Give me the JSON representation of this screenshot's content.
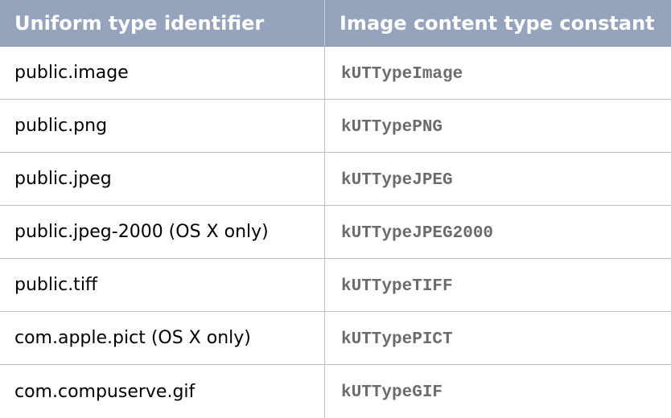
{
  "table": {
    "columns": [
      "Uniform type identifier",
      "Image content type constant"
    ],
    "rows": [
      {
        "uti": "public.image",
        "constant": "kUTTypeImage"
      },
      {
        "uti": "public.png",
        "constant": "kUTTypePNG"
      },
      {
        "uti": "public.jpeg",
        "constant": "kUTTypeJPEG"
      },
      {
        "uti": "public.jpeg-2000 (OS X only)",
        "constant": "kUTTypeJPEG2000"
      },
      {
        "uti": "public.tiff",
        "constant": "kUTTypeTIFF"
      },
      {
        "uti": "com.apple.pict (OS X only)",
        "constant": "kUTTypePICT"
      },
      {
        "uti": "com.compuserve.gif",
        "constant": "kUTTypeGIF"
      }
    ]
  },
  "colors": {
    "header_background": "#95a4bc",
    "header_text": "#ffffff",
    "grid_line": "#b5bfcf",
    "constant_text": "#6b6b6b"
  }
}
